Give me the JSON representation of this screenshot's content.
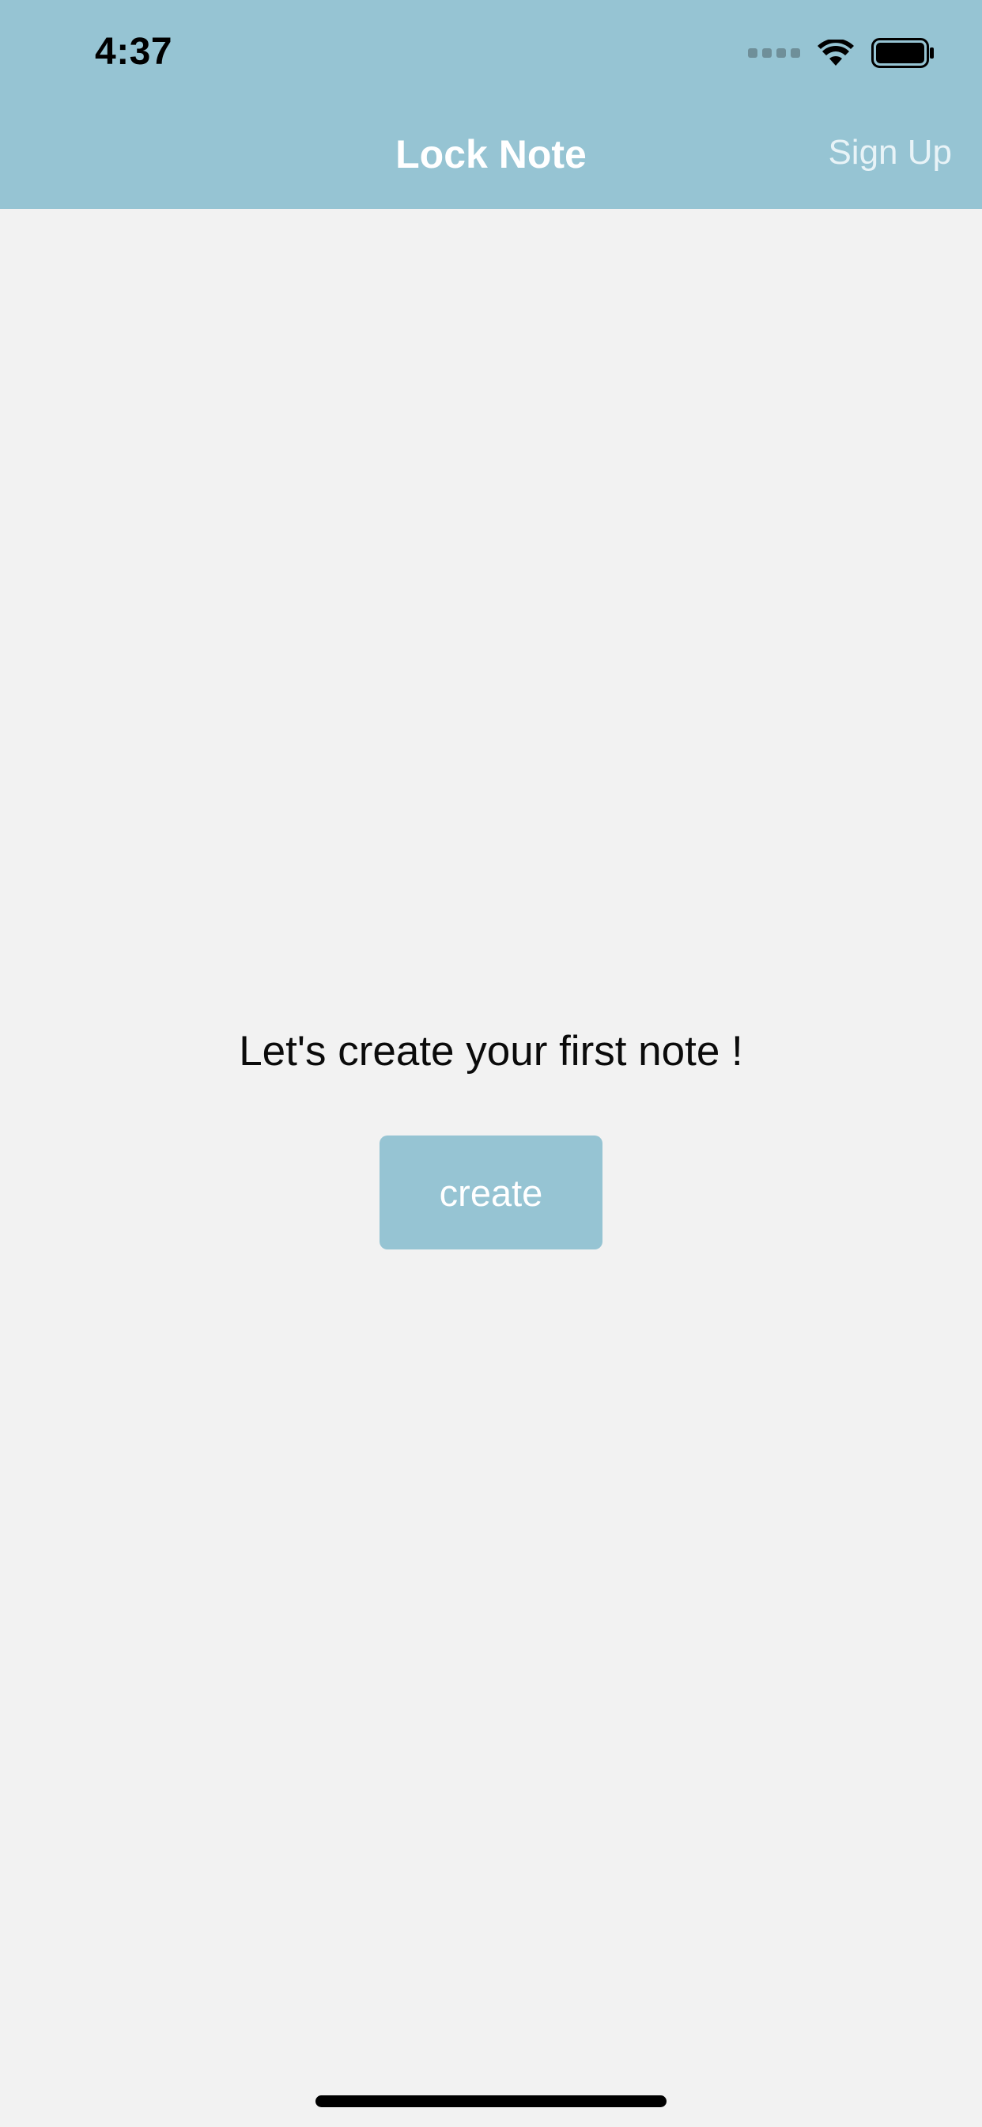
{
  "status_bar": {
    "time": "4:37",
    "icons": [
      "signal-dots-icon",
      "wifi-icon",
      "battery-icon"
    ]
  },
  "nav": {
    "title": "Lock Note",
    "right_action": "Sign Up"
  },
  "main": {
    "empty_message": "Let's create your first note !",
    "create_label": "create"
  },
  "colors": {
    "accent": "#96c4d3",
    "background": "#f2f2f2",
    "title_text": "#ffffff",
    "body_text": "#0b0b0b"
  }
}
